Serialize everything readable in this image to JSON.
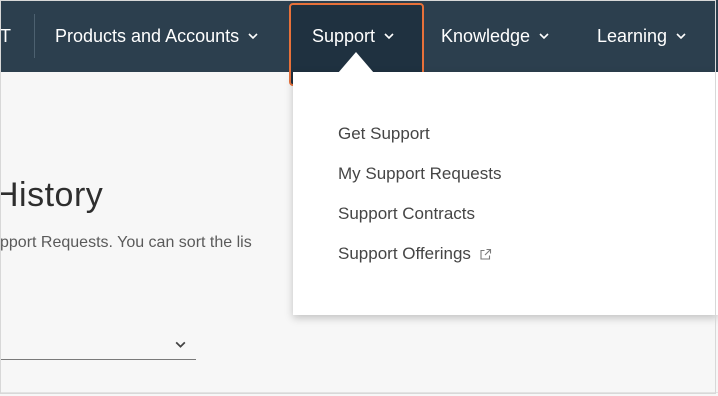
{
  "nav": {
    "left_fragment": "T",
    "items": [
      {
        "label": "Products and Accounts"
      },
      {
        "label": "Support"
      },
      {
        "label": "Knowledge"
      },
      {
        "label": "Learning"
      }
    ],
    "active_item": "Support"
  },
  "support_menu": {
    "items": [
      {
        "label": "Get Support",
        "external": false
      },
      {
        "label": "My Support Requests",
        "external": false
      },
      {
        "label": "Support Contracts",
        "external": false
      },
      {
        "label": "Support Offerings",
        "external": true
      }
    ]
  },
  "page": {
    "title_fragment": "History",
    "description_fragment": "pport Requests. You can sort the lis",
    "filter_value": ""
  },
  "colors": {
    "nav_background": "#2c3f4e",
    "active_background": "#1f3140",
    "highlight_border": "#e8713a",
    "menu_text": "#454545"
  },
  "icons": {
    "chevron": "chevron-down-icon",
    "external": "external-link-icon"
  }
}
